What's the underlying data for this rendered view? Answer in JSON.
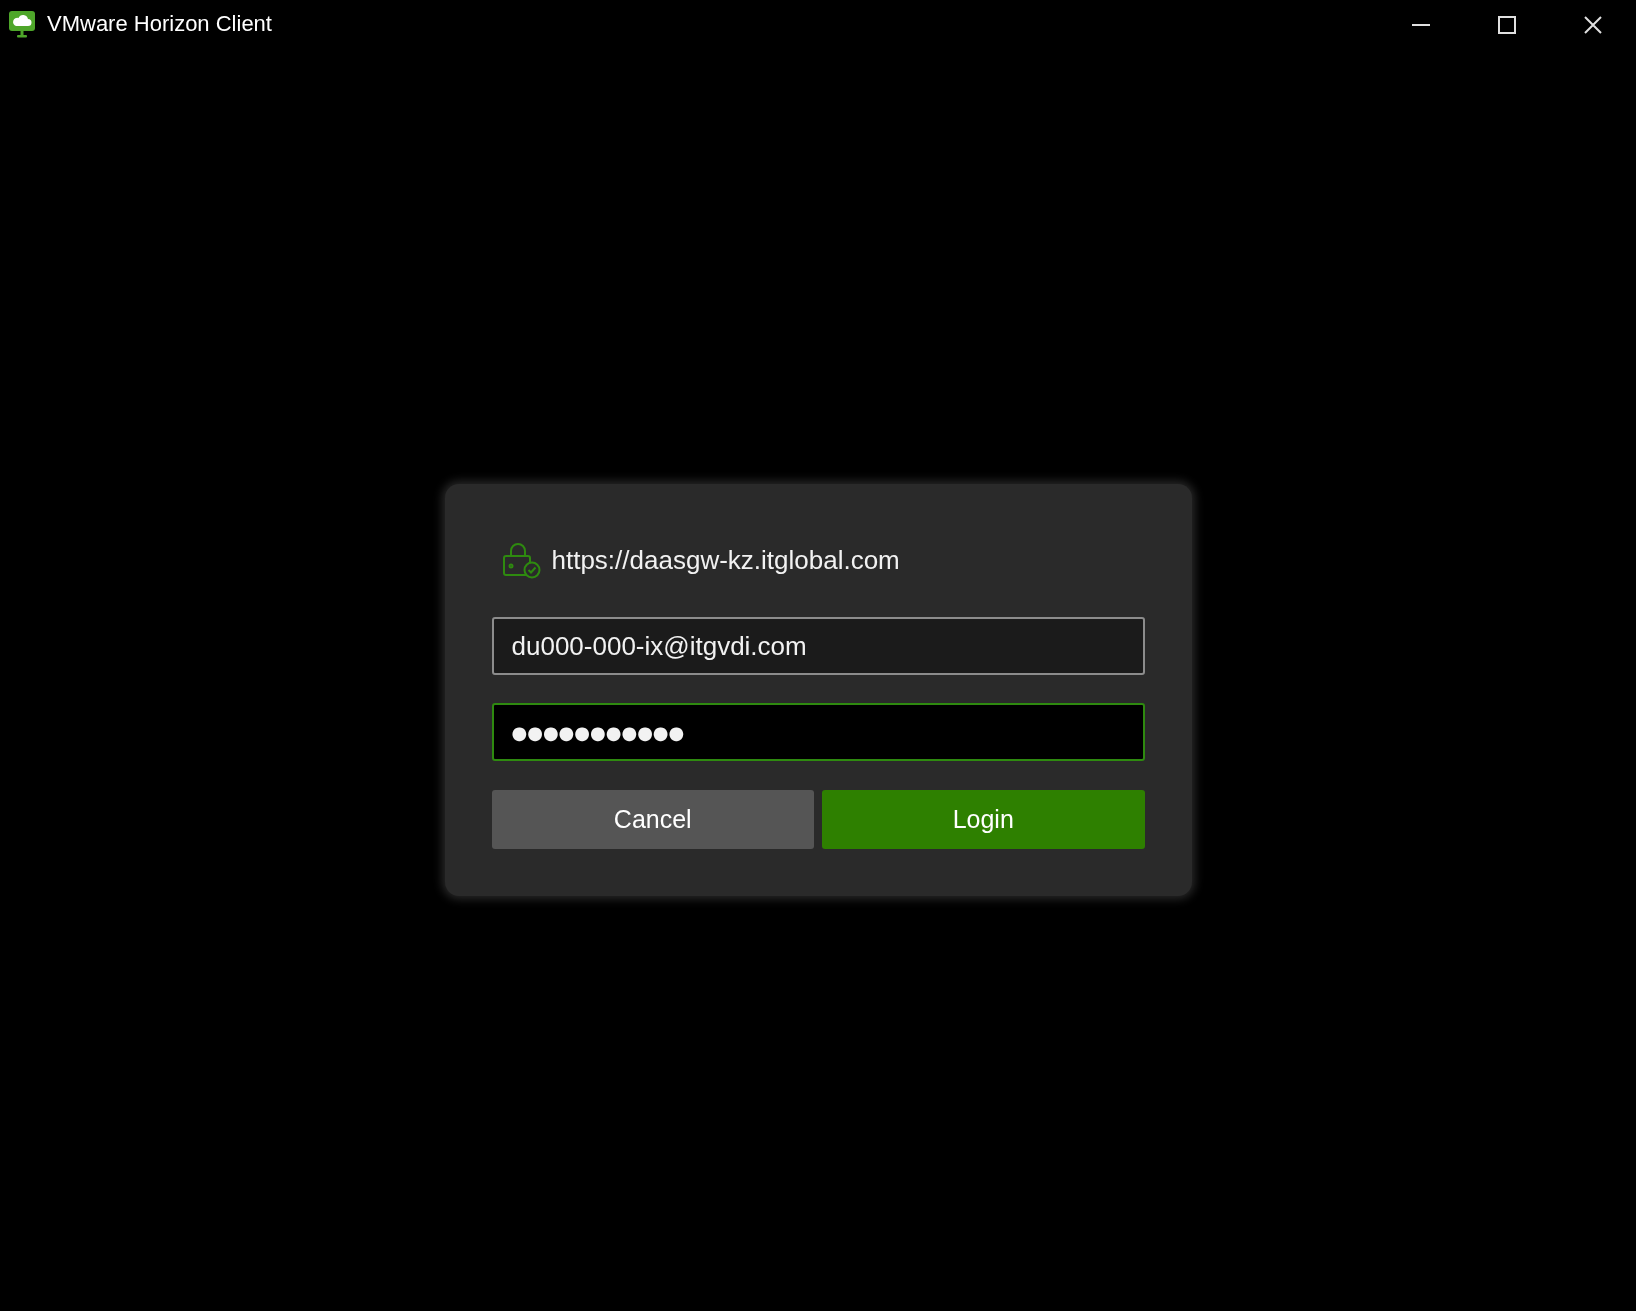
{
  "window": {
    "title": "VMware Horizon Client"
  },
  "login": {
    "server_url": "https://daasgw-kz.itglobal.com",
    "fields": [
      {
        "kind": "username",
        "value": "du000-000-ix@itgvdi.com",
        "focused": false
      },
      {
        "kind": "password",
        "value": "●●●●●●●●●●●",
        "focused": true
      }
    ],
    "buttons": [
      {
        "label": "Cancel",
        "kind": "secondary"
      },
      {
        "label": "Login",
        "kind": "primary"
      }
    ]
  }
}
